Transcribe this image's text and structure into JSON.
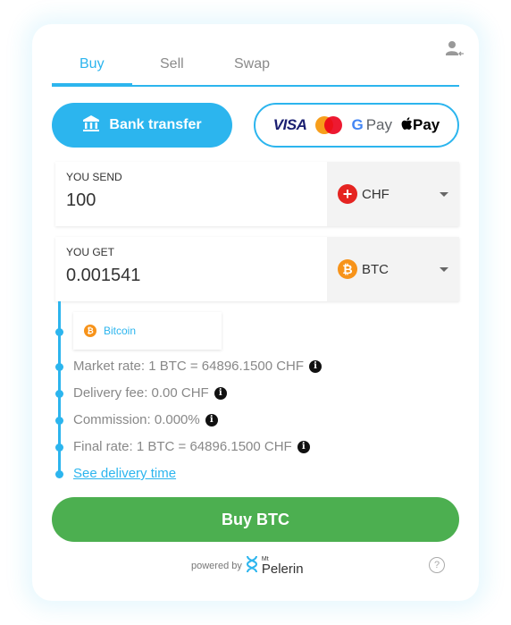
{
  "tabs": [
    {
      "label": "Buy",
      "active": true
    },
    {
      "label": "Sell",
      "active": false
    },
    {
      "label": "Swap",
      "active": false
    }
  ],
  "icons": {
    "account": "user-login-icon",
    "bank": "bank-icon",
    "help": "help-circle-icon",
    "info": "info-icon"
  },
  "payment": {
    "bank_label": "Bank transfer",
    "card_methods": {
      "visa": "VISA",
      "gpay_g": "G",
      "gpay": "Pay",
      "applepay": "Pay",
      "apple_glyph": ""
    }
  },
  "send": {
    "label": "YOU SEND",
    "value": "100",
    "currency": "CHF",
    "currency_icon": "+"
  },
  "get": {
    "label": "YOU GET",
    "value": "0.001541",
    "currency": "BTC",
    "currency_icon": "₿"
  },
  "network": {
    "label": "Bitcoin",
    "icon": "₿"
  },
  "details": [
    {
      "text": "Market rate: 1 BTC = 64896.1500 CHF"
    },
    {
      "text": "Delivery fee: 0.00 CHF"
    },
    {
      "text": "Commission: 0.000%"
    },
    {
      "text": "Final rate: 1 BTC = 64896.1500 CHF"
    }
  ],
  "delivery_link": "See delivery time",
  "cta": "Buy BTC",
  "footer": {
    "powered_by": "powered by",
    "brand_mt": "Mt",
    "brand_name": "Pelerin",
    "help": "?"
  },
  "colors": {
    "accent": "#2cb5ee",
    "cta": "#4caf50",
    "chf": "#e52421",
    "btc": "#f7931a"
  }
}
